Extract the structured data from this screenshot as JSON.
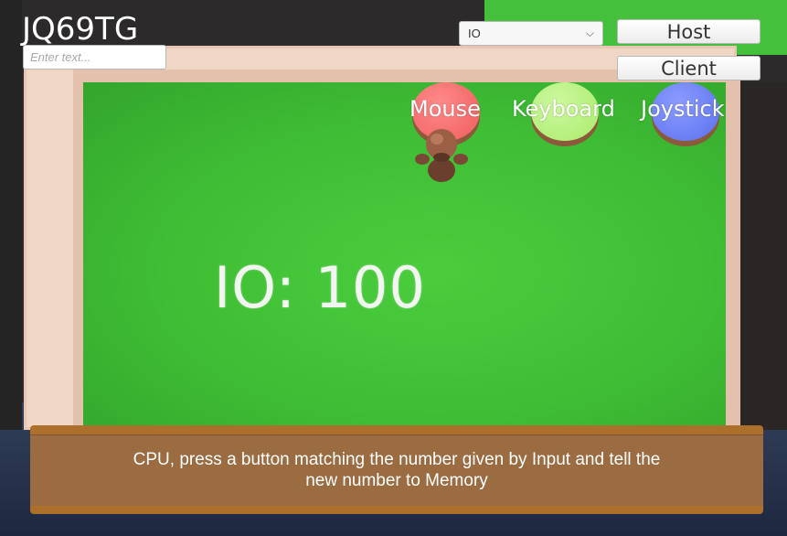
{
  "room_code": "JQ69TG",
  "name_input": {
    "value": "",
    "placeholder": "Enter text..."
  },
  "role_select": {
    "selected": "IO"
  },
  "buttons": {
    "host": "Host",
    "client": "Client"
  },
  "pads": [
    {
      "label": "Mouse",
      "color": "#f26b6b"
    },
    {
      "label": "Keyboard",
      "color": "#b6f07a"
    },
    {
      "label": "Joystick",
      "color": "#6b7ff2"
    }
  ],
  "board": {
    "io_readout": "IO: 100",
    "board_color": "#44c43a"
  },
  "instruction": "CPU, press a button matching the number given by Input and tell the new number to Memory",
  "icons": {
    "select_arrow": "chevron-down-icon",
    "player": "player-avatar-icon"
  }
}
